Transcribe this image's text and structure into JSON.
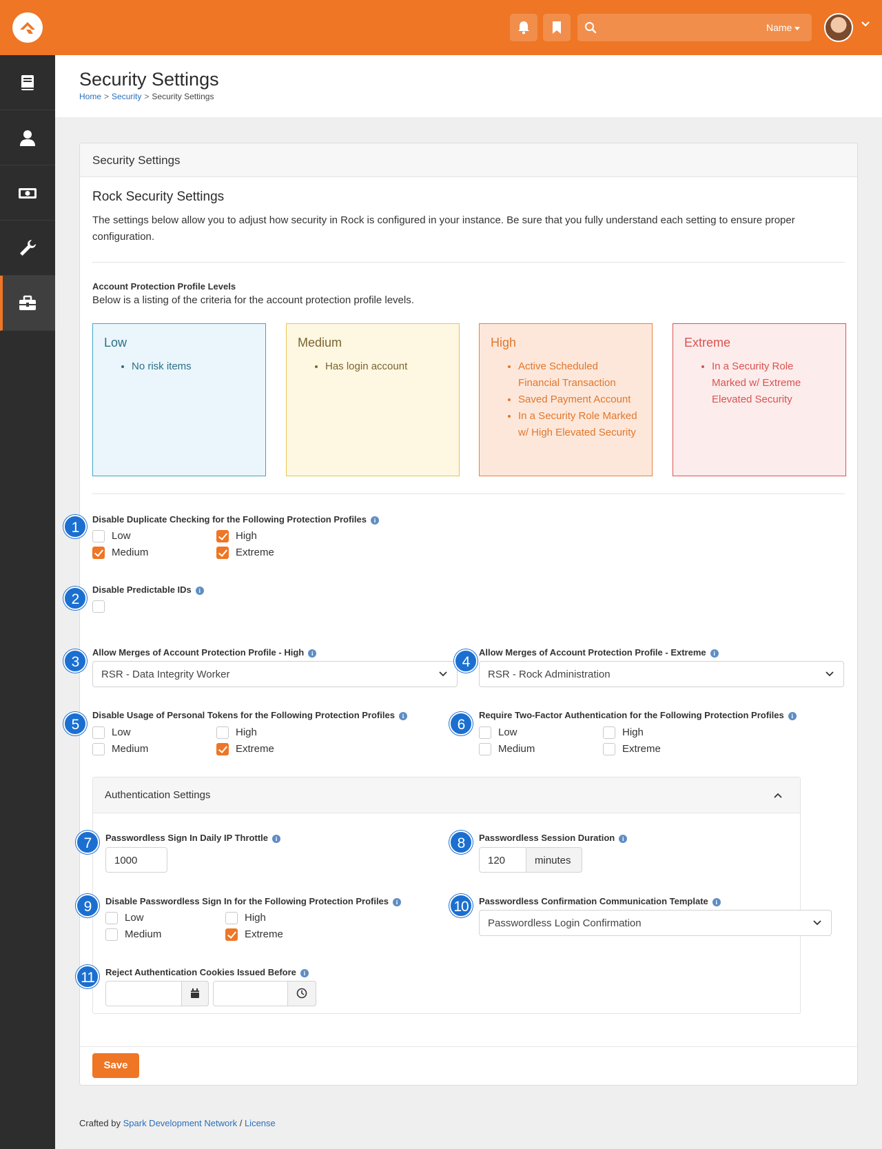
{
  "topbar": {
    "search_placeholder": "",
    "search_scope": "Name"
  },
  "colors": {
    "brand": "#ee7625",
    "badge": "#1b6fd0"
  },
  "sidenav": {
    "items": [
      {
        "icon": "book-icon"
      },
      {
        "icon": "person-icon"
      },
      {
        "icon": "money-icon"
      },
      {
        "icon": "wrench-icon"
      },
      {
        "icon": "briefcase-icon"
      }
    ]
  },
  "header": {
    "title": "Security Settings",
    "breadcrumb": [
      "Home",
      "Security",
      "Security Settings"
    ]
  },
  "panel": {
    "title": "Security Settings",
    "section_title": "Rock Security Settings",
    "intro": "The settings below allow you to adjust how security in Rock is configured in your instance. Be sure that you fully understand each setting to ensure proper configuration.",
    "levels_label": "Account Protection Profile Levels",
    "levels_desc": "Below is a listing of the criteria for the account protection profile levels.",
    "levels": {
      "low": {
        "title": "Low",
        "items": [
          "No risk items"
        ]
      },
      "medium": {
        "title": "Medium",
        "items": [
          "Has login account"
        ]
      },
      "high": {
        "title": "High",
        "items": [
          "Active Scheduled Financial Transaction",
          "Saved Payment Account",
          "In a Security Role Marked w/ High Elevated Security"
        ]
      },
      "extreme": {
        "title": "Extreme",
        "items": [
          "In a Security Role Marked w/ Extreme Elevated Security"
        ]
      }
    }
  },
  "badges": [
    "1",
    "2",
    "3",
    "4",
    "5",
    "6",
    "7",
    "8",
    "9",
    "10",
    "11"
  ],
  "form": {
    "dup_check": {
      "label": "Disable Duplicate Checking for the Following Protection Profiles",
      "options": [
        {
          "label": "Low",
          "checked": false
        },
        {
          "label": "Medium",
          "checked": true
        },
        {
          "label": "High",
          "checked": true
        },
        {
          "label": "Extreme",
          "checked": true
        }
      ]
    },
    "predictable_ids": {
      "label": "Disable Predictable IDs",
      "checked": false
    },
    "merge_high": {
      "label": "Allow Merges of Account Protection Profile - High",
      "value": "RSR - Data Integrity Worker"
    },
    "merge_extreme": {
      "label": "Allow Merges of Account Protection Profile - Extreme",
      "value": "RSR - Rock Administration"
    },
    "personal_tokens": {
      "label": "Disable Usage of Personal Tokens for the Following Protection Profiles",
      "options": [
        {
          "label": "Low",
          "checked": false
        },
        {
          "label": "Medium",
          "checked": false
        },
        {
          "label": "High",
          "checked": false
        },
        {
          "label": "Extreme",
          "checked": true
        }
      ]
    },
    "two_factor": {
      "label": "Require Two-Factor Authentication for the Following Protection Profiles",
      "options": [
        {
          "label": "Low",
          "checked": false
        },
        {
          "label": "Medium",
          "checked": false
        },
        {
          "label": "High",
          "checked": false
        },
        {
          "label": "Extreme",
          "checked": false
        }
      ]
    },
    "auth": {
      "title": "Authentication Settings",
      "ip_throttle": {
        "label": "Passwordless Sign In Daily IP Throttle",
        "value": "1000"
      },
      "session_duration": {
        "label": "Passwordless Session Duration",
        "value": "120",
        "unit": "minutes"
      },
      "disable_passwordless": {
        "label": "Disable Passwordless Sign In for the Following Protection Profiles",
        "options": [
          {
            "label": "Low",
            "checked": false
          },
          {
            "label": "Medium",
            "checked": false
          },
          {
            "label": "High",
            "checked": false
          },
          {
            "label": "Extreme",
            "checked": true
          }
        ]
      },
      "confirmation_template": {
        "label": "Passwordless Confirmation Communication Template",
        "value": "Passwordless Login Confirmation"
      },
      "reject_cookies": {
        "label": "Reject Authentication Cookies Issued Before",
        "date": "",
        "time": ""
      }
    },
    "save_label": "Save"
  },
  "footer": {
    "prefix": "Crafted by",
    "link1": "Spark Development Network",
    "sep": "/",
    "link2": "License"
  }
}
